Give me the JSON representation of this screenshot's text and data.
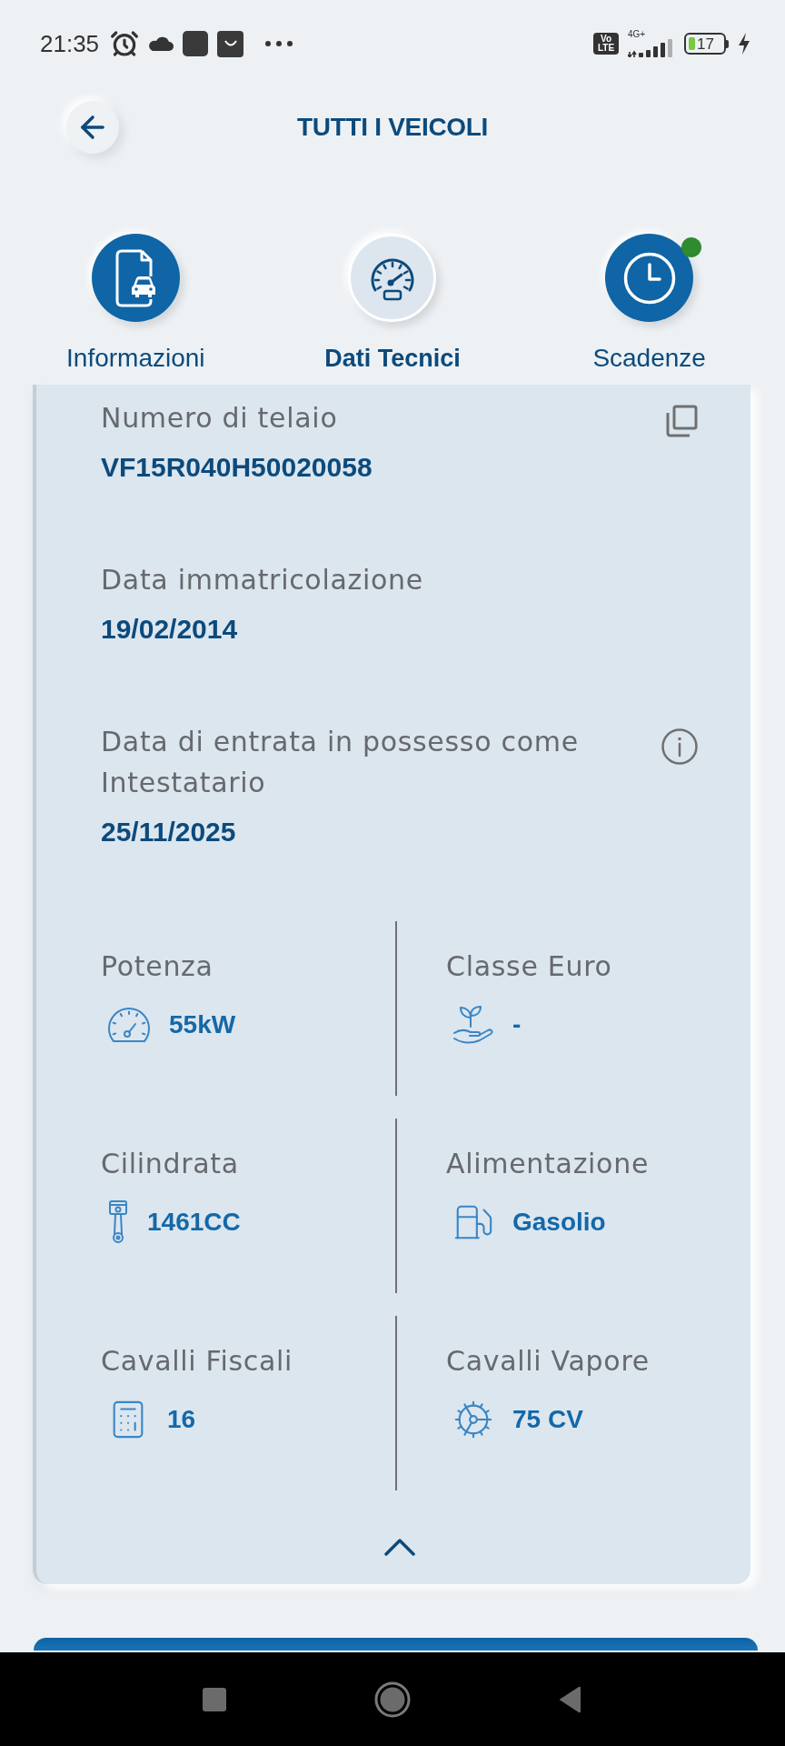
{
  "status_bar": {
    "time": "21:35",
    "network_badge": "Vo LTE",
    "network_type": "4G+",
    "battery": "17"
  },
  "header": {
    "title": "TUTTI I VEICOLI"
  },
  "tabs": [
    {
      "label": "Informazioni",
      "kind": "document",
      "selected": false,
      "notification": false
    },
    {
      "label": "Dati Tecnici",
      "kind": "speed",
      "selected": true,
      "notification": false
    },
    {
      "label": "Scadenze",
      "kind": "clock",
      "selected": false,
      "notification": true
    }
  ],
  "vehicle_card": {
    "details": [
      {
        "label": "Numero di telaio",
        "value": "VF15R040H50020058",
        "copy_button": true
      },
      {
        "label": "Data immatricolazione",
        "value": "19/02/2014"
      },
      {
        "label": "Data di entrata in possesso come Intestatario",
        "value": "25/11/2025",
        "info_button": true
      }
    ],
    "specs": [
      {
        "label": "Potenza",
        "value": "55kW",
        "kind": "power"
      },
      {
        "label": "Classe Euro",
        "value": "-",
        "kind": "emission"
      },
      {
        "label": "Cilindrata",
        "value": "1461CC",
        "kind": "displacement"
      },
      {
        "label": "Alimentazione",
        "value": "Gasolio",
        "kind": "fuel"
      },
      {
        "label": "Cavalli Fiscali",
        "value": "16",
        "kind": "fiscal"
      },
      {
        "label": "Cavalli Vapore",
        "value": "75 CV",
        "kind": "horsepower"
      }
    ],
    "expanded": true
  }
}
